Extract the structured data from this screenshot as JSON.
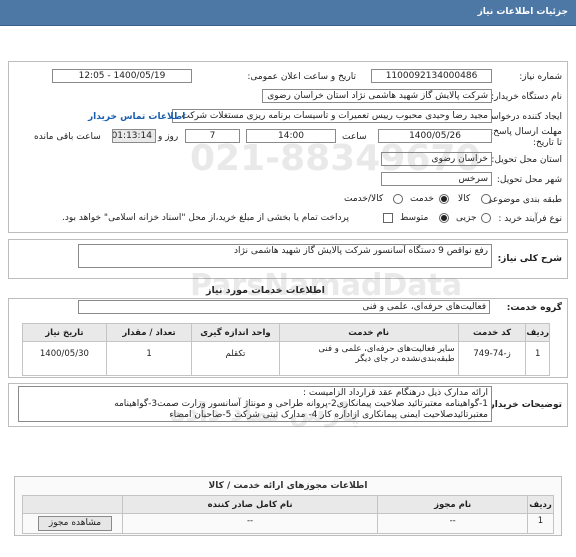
{
  "header": {
    "title": "جزئیات اطلاعات نیاز"
  },
  "info": {
    "need_number_label": "شماره نیاز:",
    "need_number": "1100092134000486",
    "announce_label": "تاریخ و ساعت اعلان عمومی:",
    "announce_value": "1400/05/19 - 12:05",
    "buyer_label": "نام دستگاه خریدار:",
    "buyer_value": "شرکت پالایش گاز شهید هاشمی نژاد   استان خراسان رضوی",
    "creator_label": "ایجاد کننده درخواست:",
    "creator_value": "مجید رضا وحیدی محبوب رییس تعمیرات و تاسیسات برنامه ریزی مستغلات شرکت",
    "contact_link": "اطلاعات تماس خریدار",
    "deadline_label": "مهلت ارسال پاسخ: تا تاریخ:",
    "deadline_date": "1400/05/26",
    "hour_label": "ساعت",
    "deadline_time": "14:00",
    "days_value": "7",
    "days_label": "روز و",
    "remaining_time": "01:13:14",
    "remaining_label": "ساعت باقی مانده",
    "province_label": "استان محل تحویل:",
    "province_value": "خراسان رضوی",
    "city_label": "شهر محل تحویل:",
    "city_value": "سرخس",
    "category_label": "طبقه بندی موضوعی:",
    "category_options": [
      "کالا",
      "خدمت",
      "کالا/خدمت"
    ],
    "category_selected": "خدمت",
    "process_label": "نوع فرآیند خرید :",
    "process_options": [
      "جزیی",
      "متوسط"
    ],
    "process_selected": "متوسط",
    "payment_text": "پرداخت تمام یا بخشی از مبلغ خرید،از محل \"اسناد خزانه اسلامی\" خواهد بود."
  },
  "summary": {
    "label": "شرح کلی نیاز:",
    "value": "رفع نواقص 9 دستگاه آسانسور شرکت پالایش گاز شهید هاشمی نژاد"
  },
  "services": {
    "section_title": "اطلاعات خدمات مورد نیاز",
    "group_label": "گروه خدمت:",
    "group_value": "فعالیت‌های حرفه‌ای، علمی و فنی",
    "columns": [
      "ردیف",
      "کد خدمت",
      "نام خدمت",
      "واحد اندازه گیری",
      "تعداد / مقدار",
      "تاریخ نیاز"
    ],
    "rows": [
      {
        "row": "1",
        "code": "ز-74-749",
        "name": "سایر فعالیت‌های حرفه‌ای، علمی و فنی طبقه‌بندی‌نشده در جای دیگر",
        "unit": "تکقلم",
        "qty": "1",
        "date": "1400/05/30"
      }
    ]
  },
  "buyer_notes": {
    "label": "توضیحات خریدار:",
    "lines": [
      "ارائه مدارک ذیل درهنگام عقد قرارداد الزامیست :",
      "1-گواهینامه معتبرتائید صلاحیت پیمانکاری2-پروانه طراحی و مونتاژ آسانسور وزارت صمت3-گواهینامه",
      "معتبرتائیدصلاحیت ایمنی پیمانکاری ازاداره کار 4- مدارک ثبتی شرکت 5-صاحبان امضاء"
    ]
  },
  "permits": {
    "title": "اطلاعات مجوزهای ارائه خدمت / کالا",
    "columns": [
      "ردیف",
      "نام مجوز",
      "نام کامل صادر کننده",
      ""
    ],
    "rows": [
      {
        "row": "1",
        "name": "--",
        "issuer": "--",
        "action": "مشاهده مجوز"
      }
    ]
  },
  "watermark": {
    "line1": "ParsNamadData",
    "line2": "پارس نماد داده",
    "line3": "021-88349670"
  }
}
